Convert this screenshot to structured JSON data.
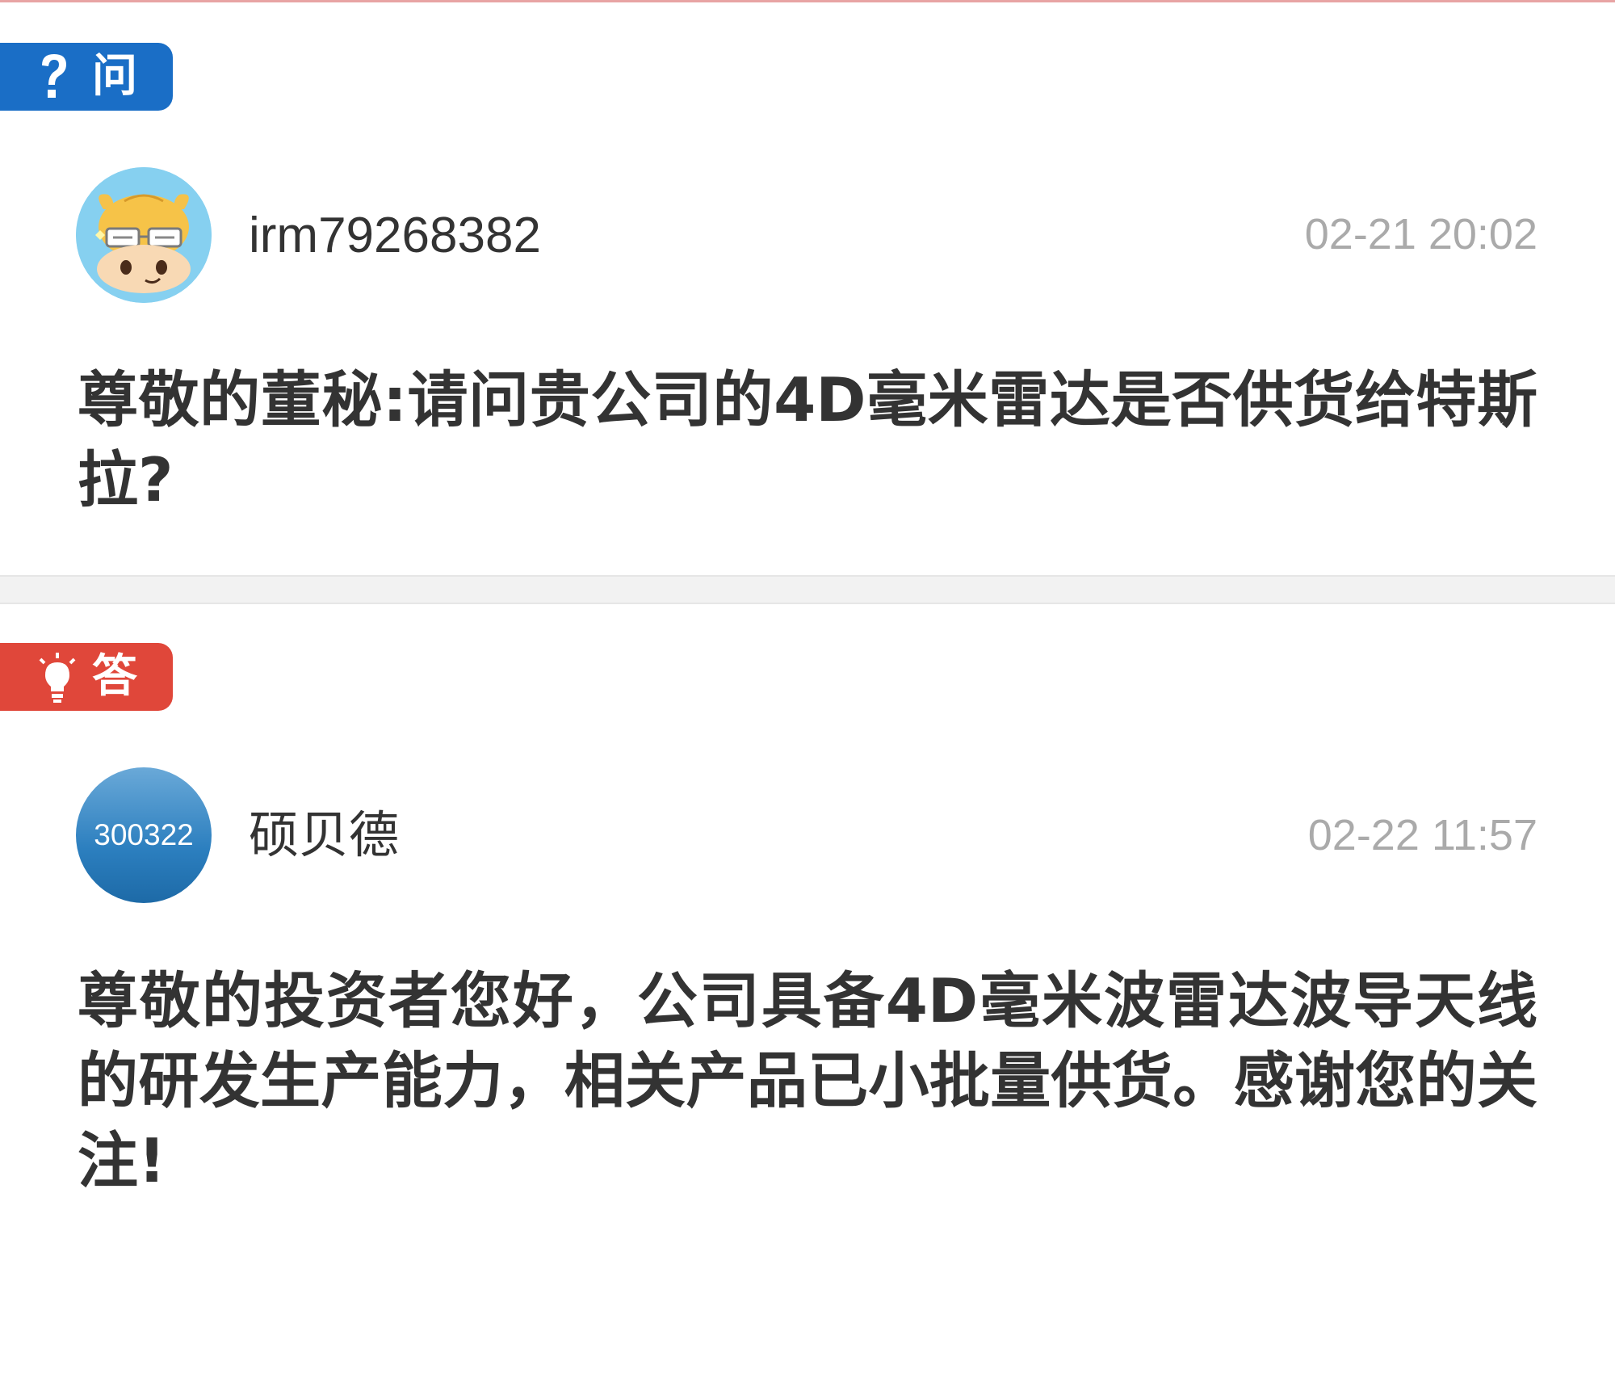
{
  "question": {
    "tag_label": "问",
    "tag_icon": "question-mark-icon",
    "tag_color": "#1a6ec6",
    "author": "irm79268382",
    "avatar": "cartoon-cow-avatar",
    "time": "02-21 20:02",
    "text": "尊敬的董秘:请问贵公司的4D毫米雷达是否供货给特斯拉?"
  },
  "answer": {
    "tag_label": "答",
    "tag_icon": "lightbulb-icon",
    "tag_color": "#e0473a",
    "author": "硕贝德",
    "avatar_text": "300322",
    "time": "02-22 11:57",
    "text": "尊敬的投资者您好，公司具备4D毫米波雷达波导天线的研发生产能力，相关产品已小批量供货。感谢您的关注!"
  }
}
